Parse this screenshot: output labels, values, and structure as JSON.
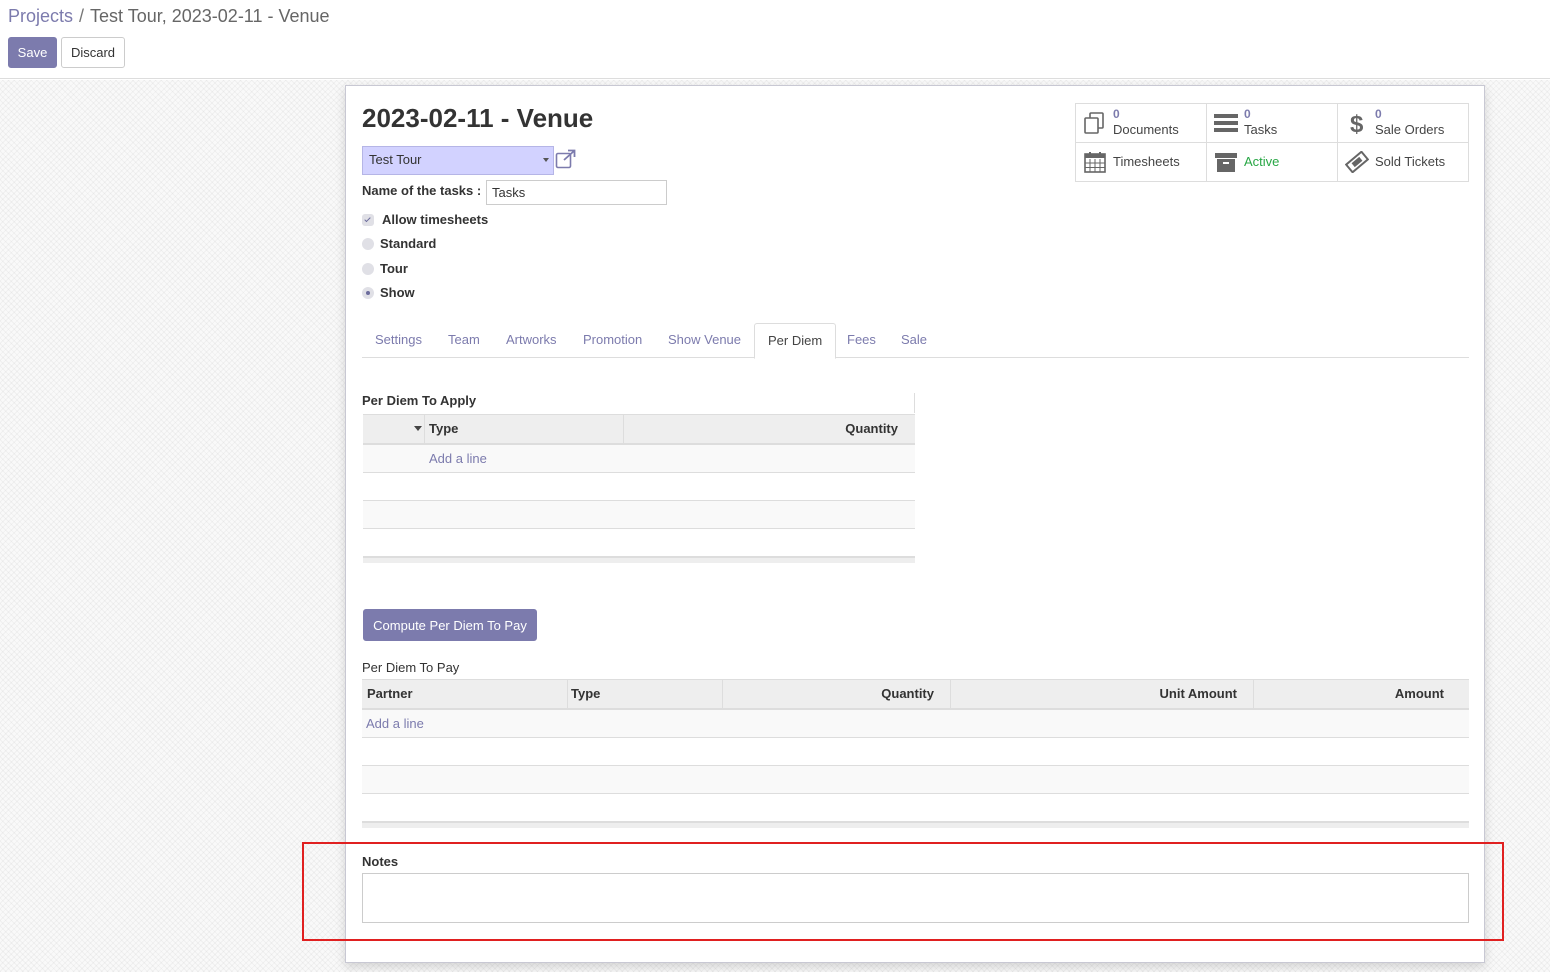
{
  "breadcrumb": {
    "root": "Projects",
    "separator": "/",
    "current": "Test Tour, 2023-02-11 - Venue"
  },
  "actions": {
    "save": "Save",
    "discard": "Discard"
  },
  "record": {
    "title": "2023-02-11 - Venue",
    "project": "Test Tour",
    "task_name_label": "Name of the tasks :",
    "task_name_value": "Tasks",
    "allow_timesheets": {
      "label": "Allow timesheets",
      "checked": true
    },
    "type_options": [
      {
        "label": "Standard",
        "checked": false
      },
      {
        "label": "Tour",
        "checked": false
      },
      {
        "label": "Show",
        "checked": true
      }
    ]
  },
  "stats": [
    {
      "count": "0",
      "label": "Documents",
      "icon": "documents-icon"
    },
    {
      "count": "0",
      "label": "Tasks",
      "icon": "tasks-icon"
    },
    {
      "count": "0",
      "label": "Sale Orders",
      "icon": "dollar-icon"
    },
    {
      "count": "",
      "label": "Timesheets",
      "icon": "calendar-icon"
    },
    {
      "count": "",
      "label": "Active",
      "icon": "archive-icon"
    },
    {
      "count": "",
      "label": "Sold Tickets",
      "icon": "ticket-icon"
    }
  ],
  "tabs": [
    "Settings",
    "Team",
    "Artworks",
    "Promotion",
    "Show Venue",
    "Per Diem",
    "Fees",
    "Sale"
  ],
  "active_tab": "Per Diem",
  "per_diem_apply": {
    "label": "Per Diem To Apply",
    "columns": [
      "Type",
      "Quantity"
    ],
    "add_line": "Add a line"
  },
  "compute_button": "Compute Per Diem To Pay",
  "per_diem_pay": {
    "label": "Per Diem To Pay",
    "columns": [
      "Partner",
      "Type",
      "Quantity",
      "Unit Amount",
      "Amount"
    ],
    "add_line": "Add a line"
  },
  "notes": {
    "label": "Notes",
    "value": ""
  },
  "colors": {
    "brand": "#7c7bad",
    "active": "#28a745",
    "highlight": "#e02020"
  }
}
